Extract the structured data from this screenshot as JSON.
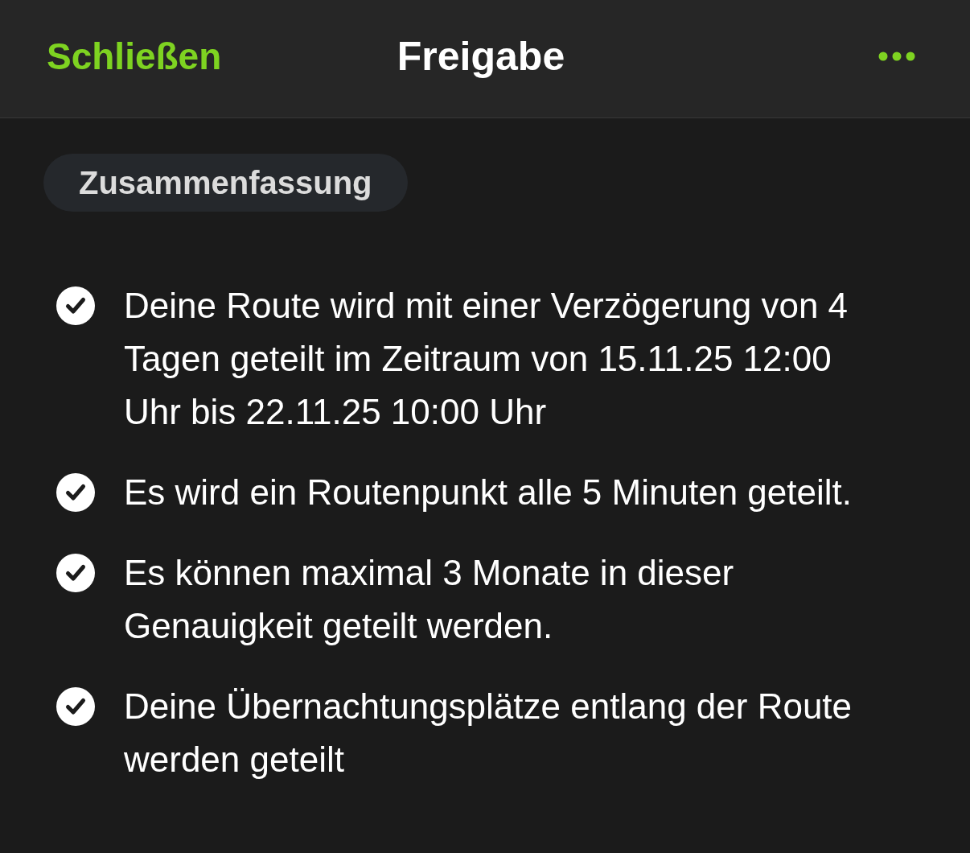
{
  "header": {
    "close_label": "Schließen",
    "title": "Freigabe"
  },
  "summary_chip": {
    "label": "Zusammenfassung"
  },
  "items": [
    {
      "text": "Deine Route wird mit einer Verzögerung von 4 Tagen geteilt im Zeitraum von 15.11.25 12:00 Uhr bis 22.11.25 10:00 Uhr",
      "checked": true
    },
    {
      "text": "Es wird ein Routenpunkt alle 5 Minuten geteilt.",
      "checked": true
    },
    {
      "text": "Es können maximal 3 Monate in dieser Genauigkeit geteilt werden.",
      "checked": true
    },
    {
      "text": "Deine Übernachtungsplätze entlang der Route werden geteilt",
      "checked": true
    }
  ]
}
